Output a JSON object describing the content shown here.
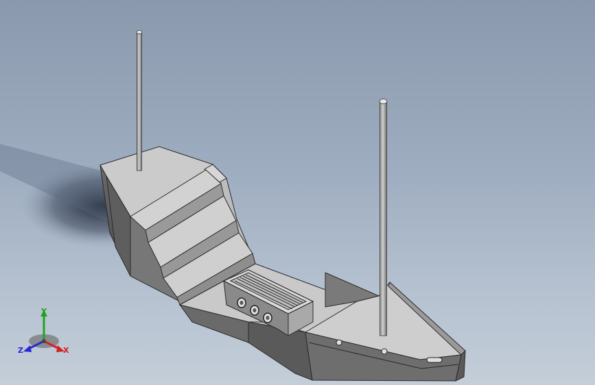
{
  "viewport": {
    "background_top": "#8a99ad",
    "background_bottom": "#c4ced9"
  },
  "model": {
    "type": "ship-3d-model",
    "part_color": "#c8c8c8",
    "edge_color": "#2a2a2a"
  },
  "triad": {
    "x_label": "X",
    "y_label": "Y",
    "z_label": "Z",
    "x_color": "#d42020",
    "y_color": "#1fa31f",
    "z_color": "#2a2ad0"
  }
}
